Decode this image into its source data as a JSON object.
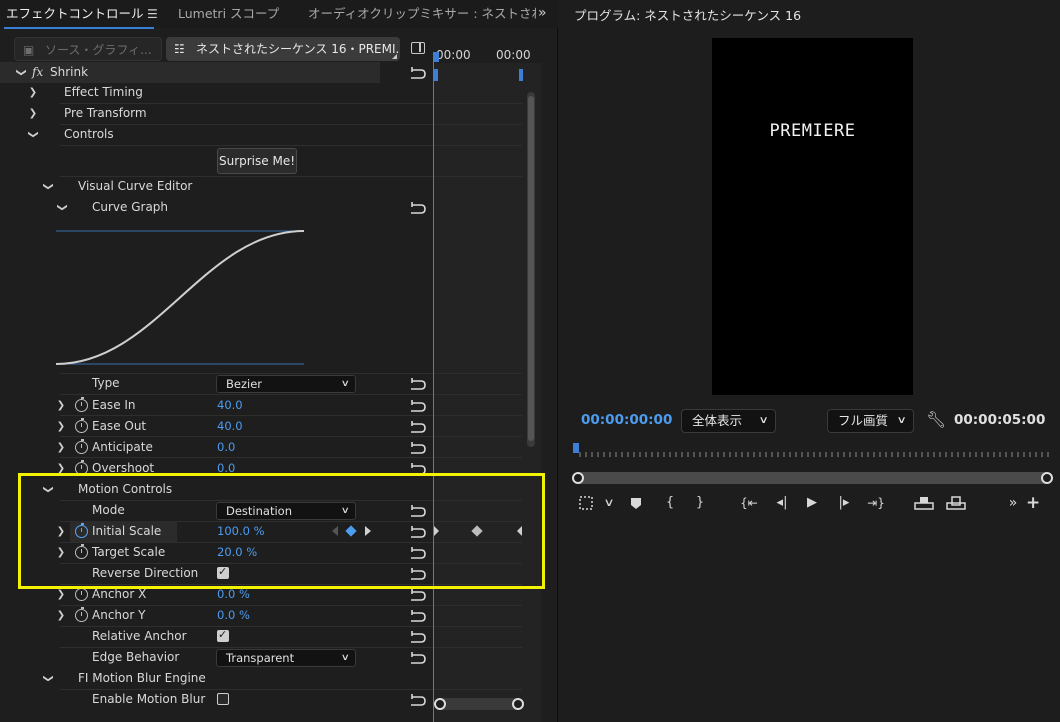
{
  "left_panel": {
    "tabs": [
      {
        "label": "エフェクトコントロール"
      },
      {
        "label": "Lumetri スコープ"
      },
      {
        "label": "オーディオクリップミキサー : ネストされ"
      }
    ],
    "source_inactive": "ソース・グラフィ...",
    "source_active": "ネストされたシーケンス 16・PREMI...",
    "timecodes": [
      "00:00",
      "00:00"
    ],
    "effect": {
      "fx_label": "fx",
      "name": "Shrink",
      "groups": {
        "effect_timing": "Effect Timing",
        "pre_transform": "Pre Transform",
        "controls": "Controls",
        "surprise_button": "Surprise Me!",
        "visual_curve_editor": "Visual Curve Editor",
        "curve_graph": "Curve Graph"
      },
      "properties": {
        "type": {
          "label": "Type",
          "value": "Bezier"
        },
        "ease_in": {
          "label": "Ease In",
          "value": "40.0"
        },
        "ease_out": {
          "label": "Ease Out",
          "value": "40.0"
        },
        "anticipate": {
          "label": "Anticipate",
          "value": "0.0"
        },
        "overshoot": {
          "label": "Overshoot",
          "value": "0.0"
        },
        "motion_controls": "Motion Controls",
        "mode": {
          "label": "Mode",
          "value": "Destination"
        },
        "initial_scale": {
          "label": "Initial Scale",
          "value": "100.0 %"
        },
        "target_scale": {
          "label": "Target Scale",
          "value": "20.0 %"
        },
        "reverse_direction": {
          "label": "Reverse Direction",
          "checked": true
        },
        "anchor_x": {
          "label": "Anchor X",
          "value": "0.0 %"
        },
        "anchor_y": {
          "label": "Anchor Y",
          "value": "0.0 %"
        },
        "relative_anchor": {
          "label": "Relative Anchor",
          "checked": true
        },
        "edge_behavior": {
          "label": "Edge Behavior",
          "value": "Transparent"
        },
        "motion_blur_engine": "FI Motion Blur Engine",
        "enable_motion_blur": {
          "label": "Enable Motion Blur",
          "checked": false
        }
      }
    }
  },
  "right_panel": {
    "title": "プログラム: ネストされたシーケンス 16",
    "monitor_text": "PREMIERE",
    "current_timecode": "00:00:00:00",
    "zoom_select": "全体表示",
    "quality_select": "フル画質",
    "duration_timecode": "00:00:05:00"
  },
  "colors": {
    "accent_blue": "#4c9cf0",
    "highlight_box": "#f3f200",
    "panel_bg": "#1e1e1e"
  }
}
